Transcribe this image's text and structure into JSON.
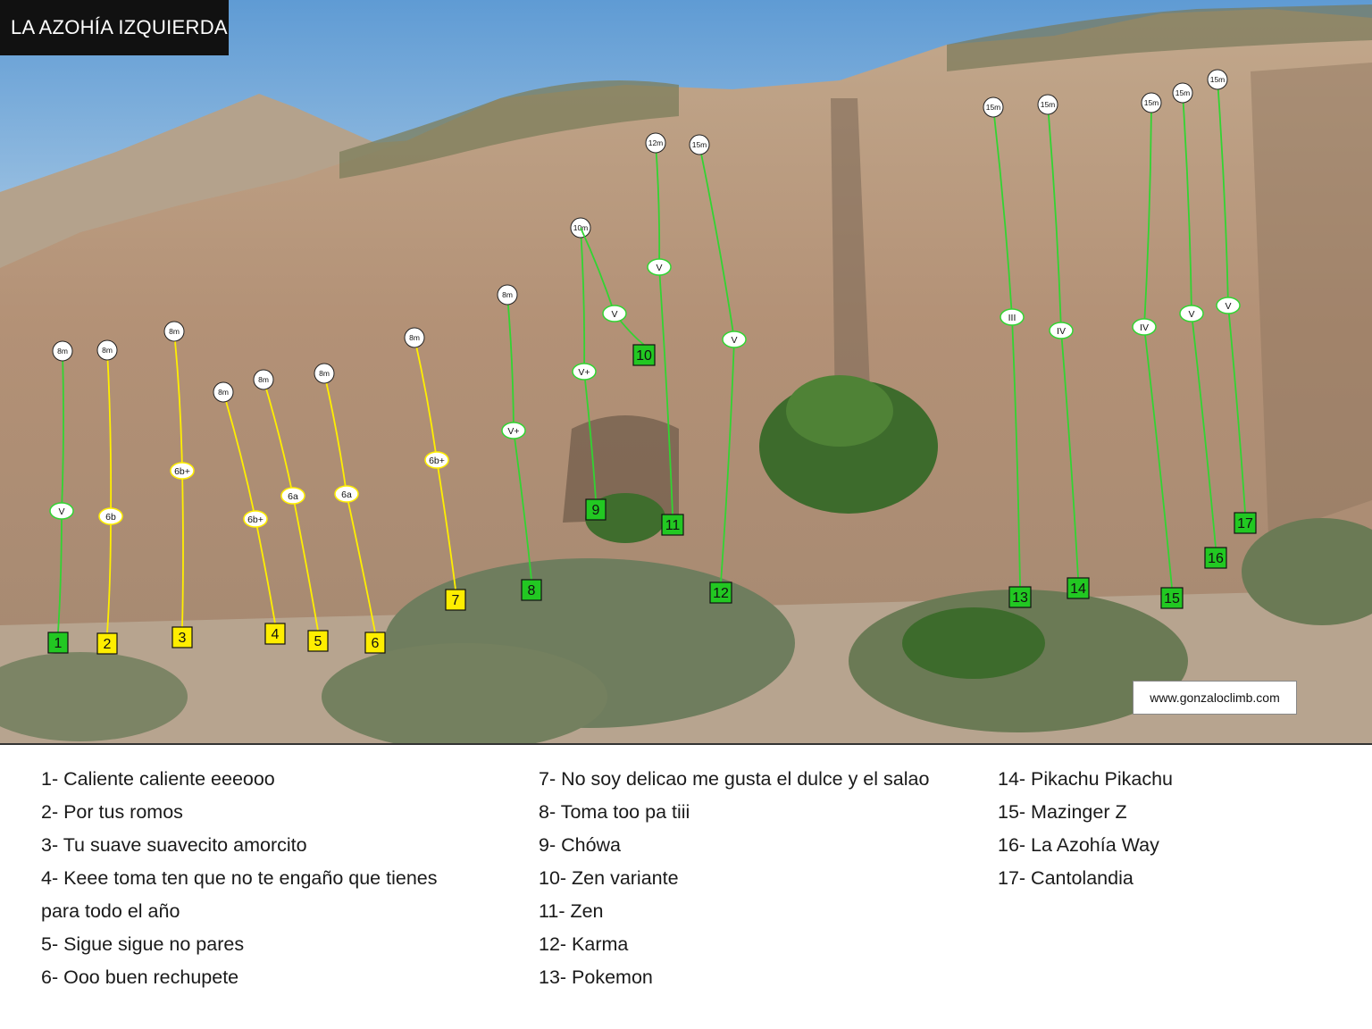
{
  "header": {
    "title": "LA AZOHÍA IZQUIERDA"
  },
  "website": "www.gonzaloclimb.com",
  "colors": {
    "sky_top": "#6fa6d8",
    "sky_bottom": "#bcd6ea",
    "rock": "#b89a7e",
    "rock_dark": "#8c735d",
    "bush": "#6f7d5e",
    "route_green": "#2fd12f",
    "route_yellow": "#ffef00",
    "palm": "#3d6b2c"
  },
  "routes": [
    {
      "number": "1",
      "length": "8m",
      "grade": "V",
      "color": "green"
    },
    {
      "number": "2",
      "length": "8m",
      "grade": "6b",
      "color": "yellow"
    },
    {
      "number": "3",
      "length": "8m",
      "grade": "6b+",
      "color": "yellow"
    },
    {
      "number": "4",
      "length": "8m",
      "grade": "6b+",
      "color": "yellow"
    },
    {
      "number": "5",
      "length": "8m",
      "grade": "6a",
      "color": "yellow"
    },
    {
      "number": "6",
      "length": "8m",
      "grade": "6a",
      "color": "yellow"
    },
    {
      "number": "7",
      "length": "8m",
      "grade": "6b+",
      "color": "yellow"
    },
    {
      "number": "8",
      "length": "8m",
      "grade": "V+",
      "color": "green"
    },
    {
      "number": "9",
      "length": "10m",
      "grade": "V+",
      "color": "green"
    },
    {
      "number": "10",
      "length": "",
      "grade": "V",
      "color": "green"
    },
    {
      "number": "11",
      "length": "12m",
      "grade": "V",
      "color": "green"
    },
    {
      "number": "12",
      "length": "15m",
      "grade": "V",
      "color": "green"
    },
    {
      "number": "13",
      "length": "15m",
      "grade": "III",
      "color": "green"
    },
    {
      "number": "14",
      "length": "15m",
      "grade": "IV",
      "color": "green"
    },
    {
      "number": "15",
      "length": "15m",
      "grade": "IV",
      "color": "green"
    },
    {
      "number": "16",
      "length": "15m",
      "grade": "V",
      "color": "green"
    },
    {
      "number": "17",
      "length": "15m",
      "grade": "V",
      "color": "green"
    }
  ],
  "legend": {
    "col1": [
      "1- Caliente caliente eeeooo",
      "2- Por tus romos",
      "3- Tu suave suavecito amorcito",
      "4- Keee toma ten que no te engaño que tienes",
      "para todo el año",
      "5- Sigue sigue no pares",
      "6- Ooo buen rechupete"
    ],
    "col2": [
      "7- No soy delicao me gusta el dulce y el salao",
      "8- Toma too pa tiii",
      "9- Chówa",
      "10- Zen variante",
      "11- Zen",
      "12- Karma",
      "13- Pokemon"
    ],
    "col3": [
      "14- Pikachu Pikachu",
      "15- Mazinger Z",
      "16- La Azohía Way",
      "17- Cantolandia"
    ]
  }
}
